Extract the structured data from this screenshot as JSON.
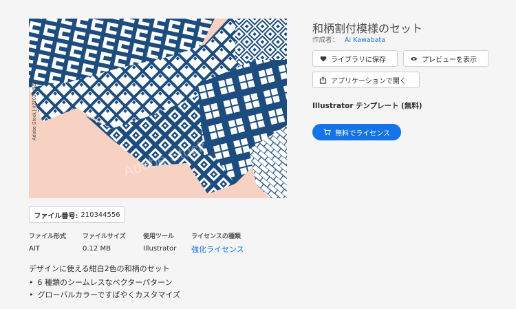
{
  "preview": {
    "watermark": "Adobe Stock | #210344556",
    "colors": {
      "navy": "#1d4d7e",
      "white": "#ffffff",
      "peach": "#f7d2c2"
    }
  },
  "title": "和柄割付模様のセット",
  "author": {
    "label": "作成者：",
    "name": "Ai Kawabata"
  },
  "buttons": {
    "library": {
      "label": "ライブラリに保存",
      "icon": "heart-icon"
    },
    "preview": {
      "label": "プレビューを表示",
      "icon": "eye-icon"
    },
    "open_app": {
      "label": "アプリケーションで開く",
      "icon": "share-icon"
    },
    "license": {
      "label": "無料でライセンス",
      "icon": "cart-icon"
    }
  },
  "template_type": {
    "app": "Illustrator",
    "kind": "テンプレート",
    "price": "(無料)"
  },
  "file_number": {
    "label": "ファイル番号:",
    "value": "210344556"
  },
  "meta": [
    {
      "key": "ファイル形式",
      "value": "AIT"
    },
    {
      "key": "ファイルサイズ",
      "value": "0.12 MB"
    },
    {
      "key": "使用ツール",
      "value": "Illustrator"
    },
    {
      "key": "ライセンスの種類",
      "value": "強化ライセンス"
    }
  ],
  "description": "デザインに使える紺白2色の和柄のセット",
  "bullets": [
    "6 種類のシームレスなベクターパターン",
    "グローバルカラーですばやくカスタマイズ"
  ],
  "accent_color": "#1473e6"
}
